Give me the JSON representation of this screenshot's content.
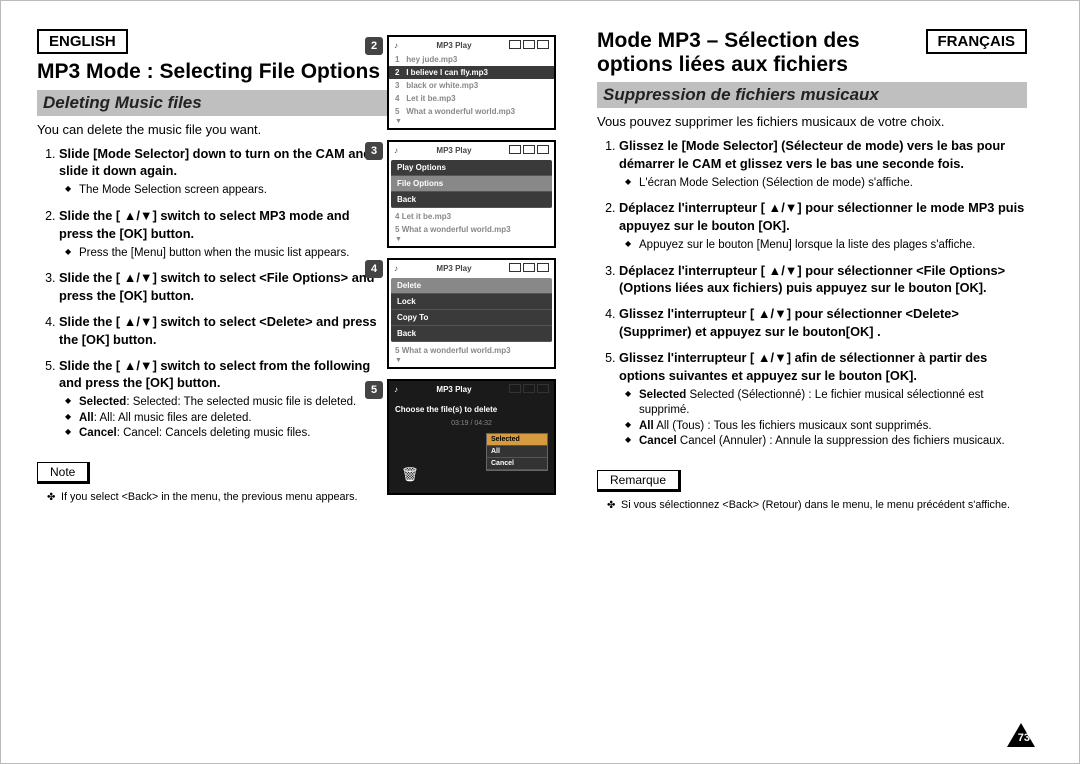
{
  "en": {
    "lang": "ENGLISH",
    "title": "MP3 Mode : Selecting File Options",
    "section": "Deleting Music files",
    "intro": "You can delete the music file you want.",
    "steps": [
      {
        "t": "Slide [Mode Selector] down to turn on the CAM and slide it down again.",
        "sub": [
          "The Mode Selection screen appears."
        ]
      },
      {
        "t": "Slide the [ ▲/▼] switch to select MP3 mode and press the [OK] button.",
        "sub": [
          "Press the [Menu] button when the music list appears."
        ]
      },
      {
        "t": "Slide the [ ▲/▼] switch to select <File Options> and press the [OK] button."
      },
      {
        "t": "Slide the [ ▲/▼] switch to select <Delete> and press the [OK] button."
      },
      {
        "t": "Slide the [ ▲/▼] switch to select from the following and press the [OK] button.",
        "sub": [
          "Selected: The selected music file is deleted.",
          "All: All music files are deleted.",
          "Cancel: Cancels deleting music files."
        ],
        "strong": [
          "Selected",
          "All",
          "Cancel"
        ]
      }
    ],
    "note_label": "Note",
    "note": "If you select <Back> in the menu, the previous menu appears."
  },
  "fr": {
    "lang": "FRANÇAIS",
    "title": "Mode MP3 – Sélection des options liées aux fichiers",
    "section": "Suppression de fichiers musicaux",
    "intro": "Vous pouvez supprimer les fichiers musicaux de votre choix.",
    "steps": [
      {
        "t": "Glissez le [Mode Selector] (Sélecteur de mode) vers le bas pour démarrer le CAM et glissez vers le bas une seconde fois.",
        "sub": [
          "L'écran Mode Selection (Sélection de mode) s'affiche."
        ]
      },
      {
        "t": "Déplacez l'interrupteur [ ▲/▼] pour sélectionner le mode MP3 puis appuyez sur le bouton [OK].",
        "sub": [
          "Appuyez sur le bouton [Menu] lorsque la liste des plages s'affiche."
        ]
      },
      {
        "t": "Déplacez l'interrupteur [ ▲/▼] pour sélectionner <File Options> (Options liées aux fichiers) puis appuyez sur le bouton [OK]."
      },
      {
        "t": "Glissez l'interrupteur [ ▲/▼] pour sélectionner <Delete> (Supprimer) et appuyez sur le bouton[OK] ."
      },
      {
        "t": "Glissez l'interrupteur [ ▲/▼] afin de sélectionner à partir des options suivantes et appuyez sur le bouton [OK].",
        "sub": [
          "Selected (Sélectionné) : Le fichier musical sélectionné est supprimé.",
          "All (Tous) : Tous les fichiers musicaux sont supprimés.",
          "Cancel (Annuler) : Annule la suppression des fichiers musicaux."
        ],
        "strong": [
          "Selected",
          "All",
          "Cancel"
        ]
      }
    ],
    "note_label": "Remarque",
    "note": "Si vous sélectionnez <Back> (Retour) dans le menu, le menu précédent s'affiche."
  },
  "screens": {
    "hdr": "MP3 Play",
    "list": [
      "hey jude.mp3",
      "I believe I can fly.mp3",
      "black or white.mp3",
      "Let it be.mp3",
      "What a wonderful world.mp3"
    ],
    "menu3": [
      "Play Options",
      "File Options",
      "Back"
    ],
    "menu4": [
      "Delete",
      "Lock",
      "Copy To",
      "Back"
    ],
    "s5_prompt": "Choose the file(s) to delete",
    "popup5": [
      "Selected",
      "All",
      "Cancel"
    ],
    "time": "03:19 / 04:32"
  },
  "page_number": "73"
}
